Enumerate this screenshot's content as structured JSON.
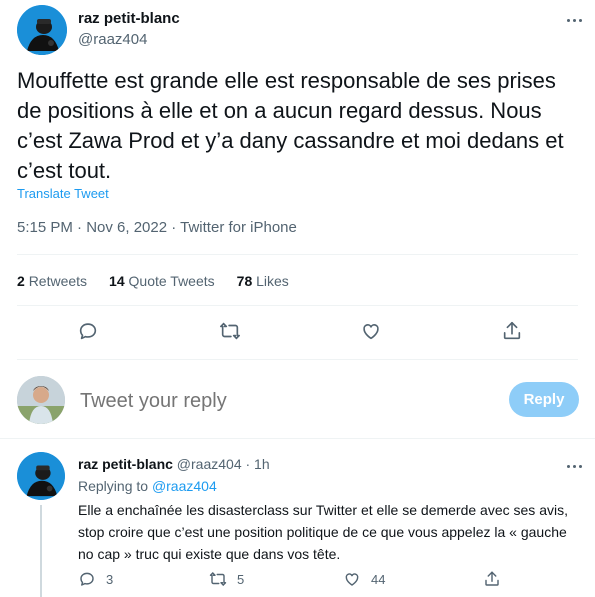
{
  "main_tweet": {
    "author_name": "raz petit-blanc",
    "author_handle": "@raaz404",
    "text": "Mouffette est grande elle est responsable de ses prises de positions à elle et on a aucun regard dessus. Nous c’est Zawa Prod et y’a dany cassandre et moi dedans et c’est tout.",
    "translate_label": "Translate Tweet",
    "timestamp": "5:15 PM · Nov 6, 2022 · Twitter for iPhone",
    "stats": {
      "retweets_count": "2",
      "retweets_label": "Retweets",
      "quotes_count": "14",
      "quotes_label": "Quote Tweets",
      "likes_count": "78",
      "likes_label": "Likes"
    }
  },
  "composer": {
    "placeholder": "Tweet your reply",
    "reply_button": "Reply"
  },
  "reply_tweet": {
    "author_name": "raz petit-blanc",
    "author_handle": "@raaz404",
    "time": "· 1h",
    "replying_to_label": "Replying to",
    "replying_to_handle": "@raaz404",
    "text": "Elle a enchaînée les disasterclass sur Twitter et elle se demerde avec ses avis, stop croire que c’est une position politique de ce que vous appelez la « gauche no cap » truc qui existe que dans vos tête.",
    "counts": {
      "replies": "3",
      "retweets": "5",
      "likes": "44"
    }
  },
  "icons": [
    "more-icon",
    "reply-icon",
    "retweet-icon",
    "like-icon",
    "share-icon"
  ],
  "colors": {
    "accent": "#1d9bf0",
    "reply_button_disabled": "#8ecdf8",
    "secondary_text": "#536471",
    "divider": "#eff3f4"
  }
}
